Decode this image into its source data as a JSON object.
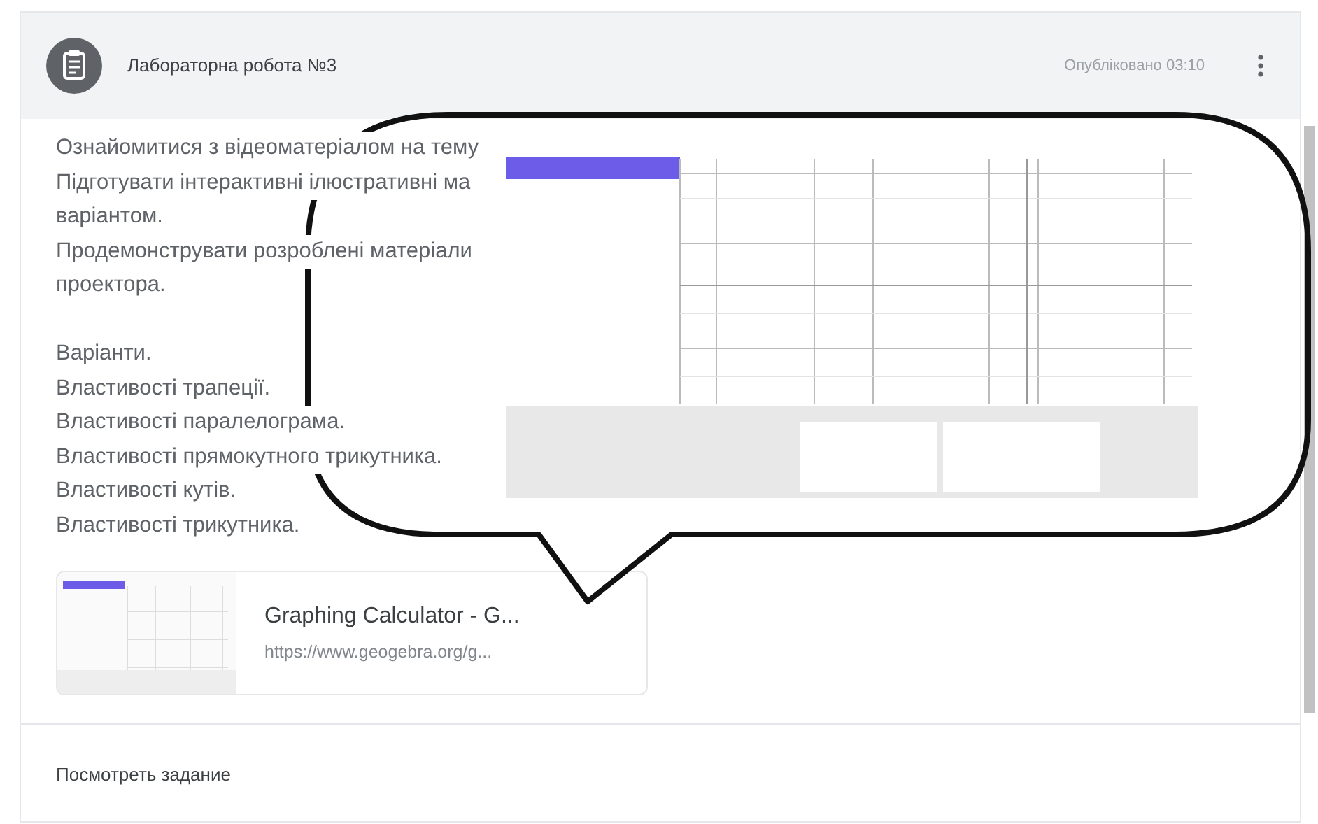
{
  "header": {
    "title": "Лабораторна робота №3",
    "published": "Опубліковано 03:10"
  },
  "description": [
    "Ознайомитися з відеоматеріалом на тему",
    "Підготувати інтерактивні ілюстративні ма",
    "варіантом.",
    "Продемонструвати розроблені матеріали",
    "проектора."
  ],
  "variants": [
    "Варіанти.",
    "Властивості трапеції.",
    "Властивості паралелограма.",
    "Властивості прямокутного трикутника.",
    "Властивості кутів.",
    "Властивості трикутника."
  ],
  "attachment": {
    "title": "Graphing Calculator - G...",
    "url": "https://www.geogebra.org/g..."
  },
  "footer_link": "Посмотреть задание"
}
